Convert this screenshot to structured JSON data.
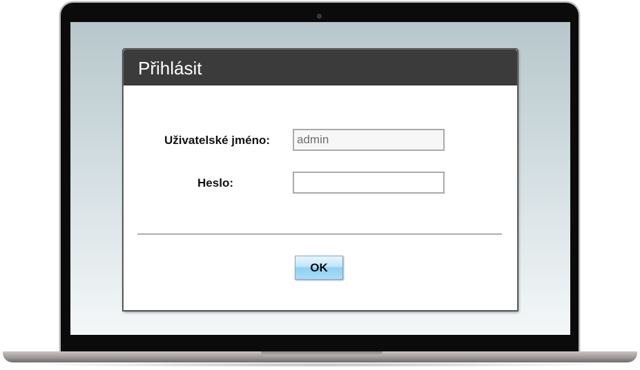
{
  "dialog": {
    "title": "Přihlásit"
  },
  "form": {
    "username_label": "Uživatelské jméno:",
    "username_value": "admin",
    "password_label": "Heslo:",
    "password_value": ""
  },
  "actions": {
    "ok_label": "OK"
  },
  "colors": {
    "header_bg": "#3b3b3b",
    "button_accent": "#8fd0f4"
  }
}
